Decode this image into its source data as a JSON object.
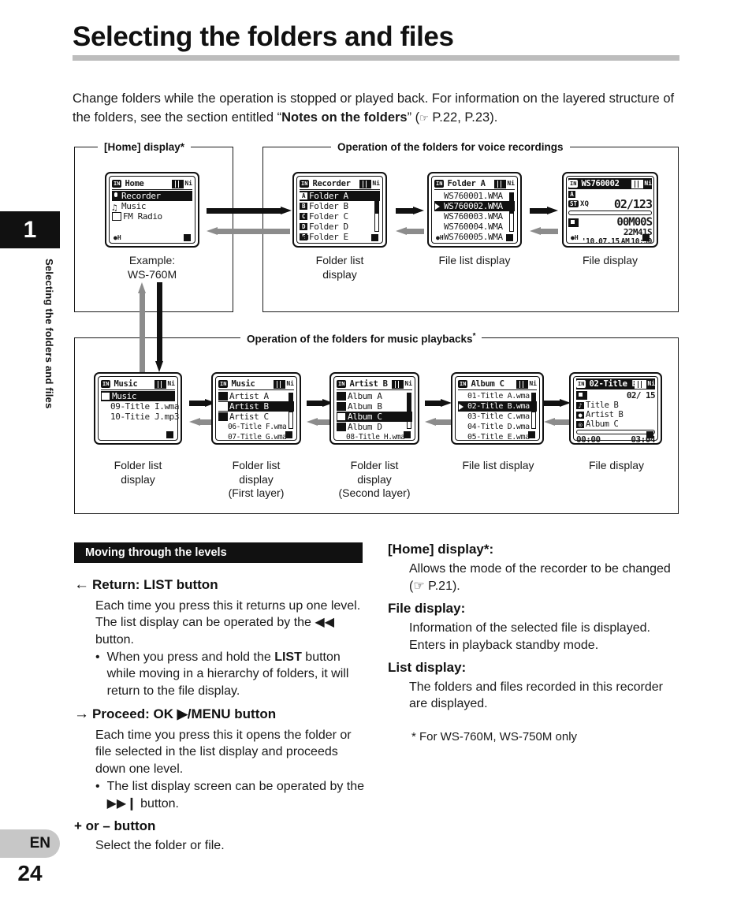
{
  "sidebar": {
    "chapter_number": "1",
    "chapter_title": "Selecting the folders and files",
    "language": "EN",
    "page_number": "24"
  },
  "header": {
    "title": "Selecting the folders and files",
    "intro_part1": "Change folders while the operation is stopped or played back. For information on the layered structure of the folders, see the section entitled “",
    "intro_bold": "Notes on the folders",
    "intro_part2": "” (",
    "intro_ref": "P.22, P.23).",
    "pointer_icon": "☞"
  },
  "diagram": {
    "group_home_title": "[Home] display*",
    "group_voice_title": "Operation of the folders for voice recordings",
    "group_music_title": "Operation of the folders for music playbacks",
    "group_music_asterisk": "*",
    "screens": {
      "home": {
        "title": "Home",
        "in_badge": "IN",
        "battery": "Ni",
        "rows": [
          {
            "icon": "mic-icon",
            "label": "Recorder",
            "selected": true
          },
          {
            "icon": "note-icon",
            "label": "Music",
            "selected": false
          },
          {
            "icon": "radio-icon",
            "label": "FM Radio",
            "selected": false
          }
        ],
        "caption": "Example:\nWS-760M"
      },
      "recorder": {
        "title": "Recorder",
        "in_badge": "IN",
        "battery": "Ni",
        "rows": [
          {
            "icon": "A",
            "label": "Folder A",
            "selected": true
          },
          {
            "icon": "B",
            "label": "Folder B",
            "selected": false
          },
          {
            "icon": "C",
            "label": "Folder C",
            "selected": false
          },
          {
            "icon": "D",
            "label": "Folder D",
            "selected": false
          },
          {
            "icon": "E",
            "label": "Folder E",
            "selected": false
          }
        ],
        "caption": "Folder list\ndisplay"
      },
      "folder_a": {
        "title": "Folder A",
        "in_badge": "IN",
        "battery": "Ni",
        "rows": [
          {
            "icon": "",
            "label": "WS760001.WMA",
            "selected": false
          },
          {
            "icon": "play-icon",
            "label": "WS760002.WMA",
            "selected": true
          },
          {
            "icon": "",
            "label": "WS760003.WMA",
            "selected": false
          },
          {
            "icon": "",
            "label": "WS760004.WMA",
            "selected": false
          },
          {
            "icon": "",
            "label": "WS760005.WMA",
            "selected": false
          }
        ],
        "caption": "File list display"
      },
      "file_voice": {
        "title": "WS760002",
        "in_badge": "IN",
        "battery": "Ni",
        "folder_badge": "A",
        "quality_badge": "ST",
        "mode_badge": "XQ",
        "file_counter": "02/123",
        "elapsed": "00M00S",
        "total": "22M41S",
        "date": "'10.07.15",
        "ampm": "AM",
        "time": "10:30",
        "caption": "File display"
      },
      "music_root": {
        "title": "Music",
        "in_badge": "IN",
        "battery": "Ni",
        "rows": [
          {
            "icon": "folder-icon",
            "label": "Music",
            "selected": true
          },
          {
            "icon": "",
            "label": "09-Title I.wma",
            "selected": false
          },
          {
            "icon": "",
            "label": "10-Titie J.mp3",
            "selected": false
          }
        ],
        "caption": "Folder list\ndisplay"
      },
      "music_artists": {
        "title": "Music",
        "in_badge": "IN",
        "battery": "Ni",
        "rows": [
          {
            "icon": "folder-icon",
            "label": "Artist A",
            "selected": false
          },
          {
            "icon": "folder-icon",
            "label": "Artist B",
            "selected": true
          },
          {
            "icon": "folder-icon",
            "label": "Artist C",
            "selected": false
          },
          {
            "icon": "",
            "label": "06-Title F.wma",
            "selected": false
          },
          {
            "icon": "",
            "label": "07-Title G.wma",
            "selected": false
          }
        ],
        "caption": "Folder list\ndisplay\n(First layer)"
      },
      "music_albums": {
        "title": "Artist B",
        "in_badge": "IN",
        "battery": "Ni",
        "rows": [
          {
            "icon": "folder-icon",
            "label": "Album A",
            "selected": false
          },
          {
            "icon": "folder-icon",
            "label": "Album B",
            "selected": false
          },
          {
            "icon": "folder-icon",
            "label": "Album C",
            "selected": true
          },
          {
            "icon": "folder-icon",
            "label": "Album D",
            "selected": false
          },
          {
            "icon": "",
            "label": "08-Title H.wma",
            "selected": false
          }
        ],
        "caption": "Folder list\ndisplay\n(Second layer)"
      },
      "album_c": {
        "title": "Album C",
        "in_badge": "IN",
        "battery": "Ni",
        "rows": [
          {
            "icon": "",
            "label": "01-Title A.wma",
            "selected": false
          },
          {
            "icon": "play-icon",
            "label": "02-Title B.wma",
            "selected": true
          },
          {
            "icon": "",
            "label": "03-Title C.wma",
            "selected": false
          },
          {
            "icon": "",
            "label": "04-Title D.wma",
            "selected": false
          },
          {
            "icon": "",
            "label": "05-Title E.wma",
            "selected": false
          }
        ],
        "caption": "File list display"
      },
      "file_music": {
        "title": "02-Title B",
        "in_badge": "IN",
        "battery": "Ni",
        "file_counter": "02/ 15",
        "track": "Title B",
        "artist": "Artist B",
        "album": "Album C",
        "elapsed": "00:00",
        "total": "03:04",
        "caption": "File display"
      }
    }
  },
  "instructions": {
    "section_title": "Moving through the levels",
    "left": [
      {
        "arrow": "←",
        "heading": "Return: LIST button",
        "body": "Each time you press this it returns up one level. The list display can be operated by the ◀◀ button.",
        "bullet_pre": "When you press and hold the ",
        "bullet_bold": "LIST",
        "bullet_post": " button while moving in a hierarchy of folders, it will return to the file display."
      },
      {
        "arrow": "→",
        "heading": "Proceed: OK ▶/MENU button",
        "body": "Each time you press this it opens the folder or file selected in the list display and proceeds down one level.",
        "bullet_pre": "The list display screen can be operated by the ▶▶❙ button.",
        "bullet_bold": "",
        "bullet_post": ""
      },
      {
        "arrow": "",
        "heading": "+ or – button",
        "body": "Select the folder or file.",
        "bullet_pre": "",
        "bullet_bold": "",
        "bullet_post": ""
      }
    ],
    "right": [
      {
        "heading": "[Home] display*:",
        "body": "Allows the mode of the recorder to be changed (☞ P.21)."
      },
      {
        "heading": "File display:",
        "body": "Information of the selected file is displayed. Enters in playback standby mode."
      },
      {
        "heading": "List display:",
        "body": "The folders and files recorded in this recorder are displayed."
      }
    ],
    "footnote": "* For WS-760M, WS-750M only"
  },
  "colors": {
    "accent_black": "#111111",
    "rule_gray": "#bdbdbd",
    "arrow_gray": "#8c8c8c",
    "badge_gray": "#c7c7c7"
  }
}
